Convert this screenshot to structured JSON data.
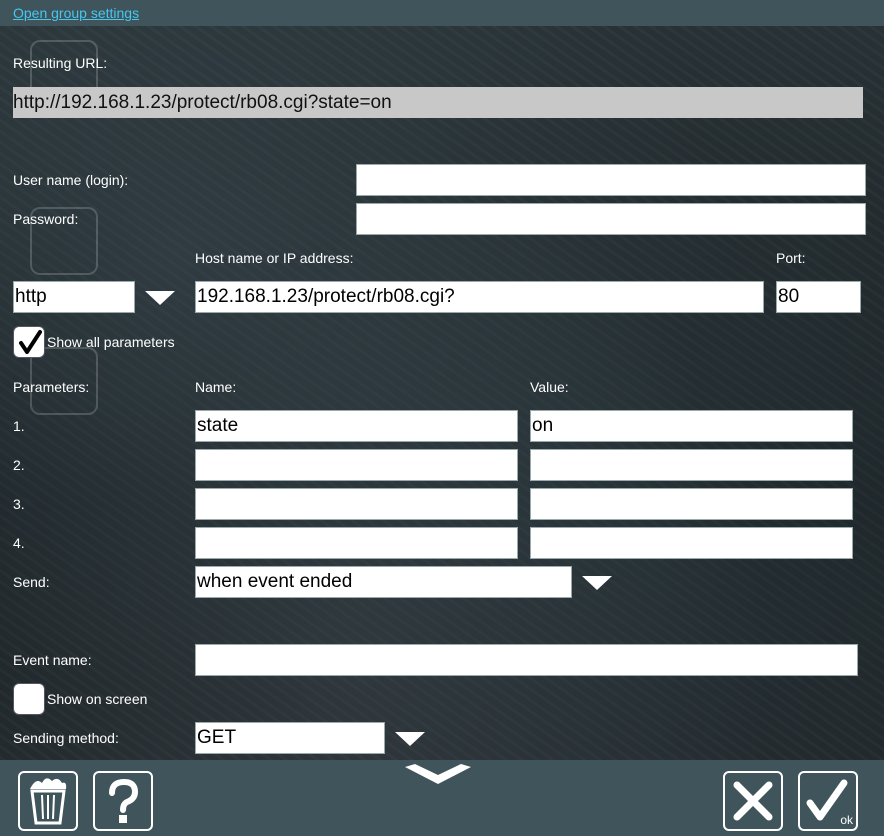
{
  "header": {
    "group_settings_link": "Open group settings"
  },
  "form": {
    "resulting_url_label": "Resulting URL:",
    "resulting_url": "http://192.168.1.23/protect/rb08.cgi?state=on",
    "username_label": "User name (login):",
    "username_value": "",
    "password_label": "Password:",
    "password_value": "",
    "host_label": "Host name or IP address:",
    "port_label": "Port:",
    "protocol_value": "http",
    "host_value": "192.168.1.23/protect/rb08.cgi?",
    "port_value": "80",
    "show_all_params_label": "Show all parameters",
    "show_all_params_checked": true,
    "parameters_label": "Parameters:",
    "name_col_label": "Name:",
    "value_col_label": "Value:",
    "parameters": [
      {
        "index": "1.",
        "name": "state",
        "value": "on"
      },
      {
        "index": "2.",
        "name": "",
        "value": ""
      },
      {
        "index": "3.",
        "name": "",
        "value": ""
      },
      {
        "index": "4.",
        "name": "",
        "value": ""
      }
    ],
    "send_label": "Send:",
    "send_value": "when event ended",
    "event_name_label": "Event name:",
    "event_name_value": "",
    "show_on_screen_label": "Show on screen",
    "show_on_screen_checked": false,
    "sending_method_label": "Sending method:",
    "sending_method_value": "GET"
  },
  "footer": {
    "delete_icon": "trash-icon",
    "help_icon": "question-icon",
    "collapse_icon": "chevron-down-icon",
    "cancel_icon": "close-icon",
    "ok_icon": "check-icon",
    "ok_label": "ok"
  },
  "colors": {
    "bar_background": "#3f545b",
    "link": "#46c8f0",
    "url_box": "#c8c8c8"
  }
}
